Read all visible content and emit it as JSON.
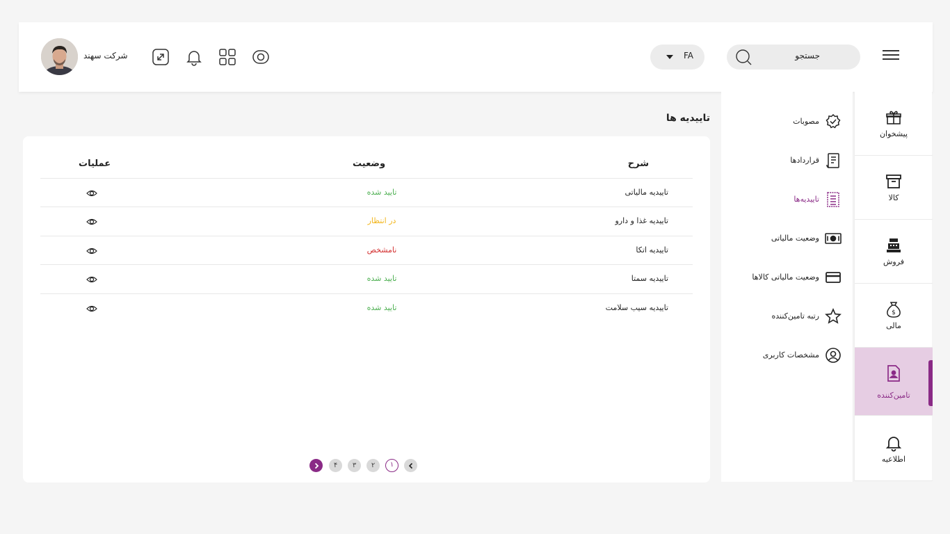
{
  "header": {
    "search_placeholder": "جستجو",
    "language": "FA",
    "company_name": "شرکت سهند",
    "icons": [
      "eye-icon",
      "grid-icon",
      "bell-icon",
      "expand-icon"
    ]
  },
  "rail": {
    "items": [
      {
        "label": "پیشخوان",
        "icon": "gift-icon"
      },
      {
        "label": "کالا",
        "icon": "archive-box-icon"
      },
      {
        "label": "فروش",
        "icon": "cash-register-icon"
      },
      {
        "label": "مالی",
        "icon": "money-bag-icon"
      },
      {
        "label": "تامین‌کننده",
        "icon": "supplier-file-icon",
        "active": true
      },
      {
        "label": "اطلاعیه",
        "icon": "bell-icon"
      }
    ]
  },
  "submenu": {
    "items": [
      {
        "label": "مصوبات",
        "icon": "verified-badge-icon"
      },
      {
        "label": "قراردادها",
        "icon": "contract-icon"
      },
      {
        "label": "تاییدیه‌ها",
        "icon": "receipt-icon",
        "active": true
      },
      {
        "label": "وضعیت مالیاتی",
        "icon": "banknote-icon"
      },
      {
        "label": "وضعیت مالیاتی کالاها",
        "icon": "credit-card-icon"
      },
      {
        "label": "رتبه تامین‌کننده",
        "icon": "star-icon"
      },
      {
        "label": "مشخصات کاربری",
        "icon": "user-circle-icon"
      }
    ]
  },
  "page": {
    "title": "تاییدیه ها"
  },
  "table": {
    "headers": {
      "description": "شرح",
      "status": "وضعیت",
      "actions": "عملیات"
    },
    "rows": [
      {
        "description": "تاییدیه مالیاتی",
        "status": "تایید شده",
        "status_color": "#4caf50"
      },
      {
        "description": "تاییدیه غذا و دارو",
        "status": "در انتظار",
        "status_color": "#f2b51b"
      },
      {
        "description": "تاییدیه اتکا",
        "status": "نامشخص",
        "status_color": "#d32f2f"
      },
      {
        "description": "تاییدیه سمتا",
        "status": "تایید شده",
        "status_color": "#4caf50"
      },
      {
        "description": "تاییدیه سیب سلامت",
        "status": "تایید شده",
        "status_color": "#4caf50"
      }
    ]
  },
  "pagination": {
    "pages": [
      "۱",
      "۲",
      "۳",
      "۴"
    ],
    "current": "۱"
  },
  "colors": {
    "accent": "#8a2a86",
    "active_bg": "#e6cde3",
    "approved": "#4caf50",
    "pending": "#f2b51b",
    "unknown": "#d32f2f"
  }
}
